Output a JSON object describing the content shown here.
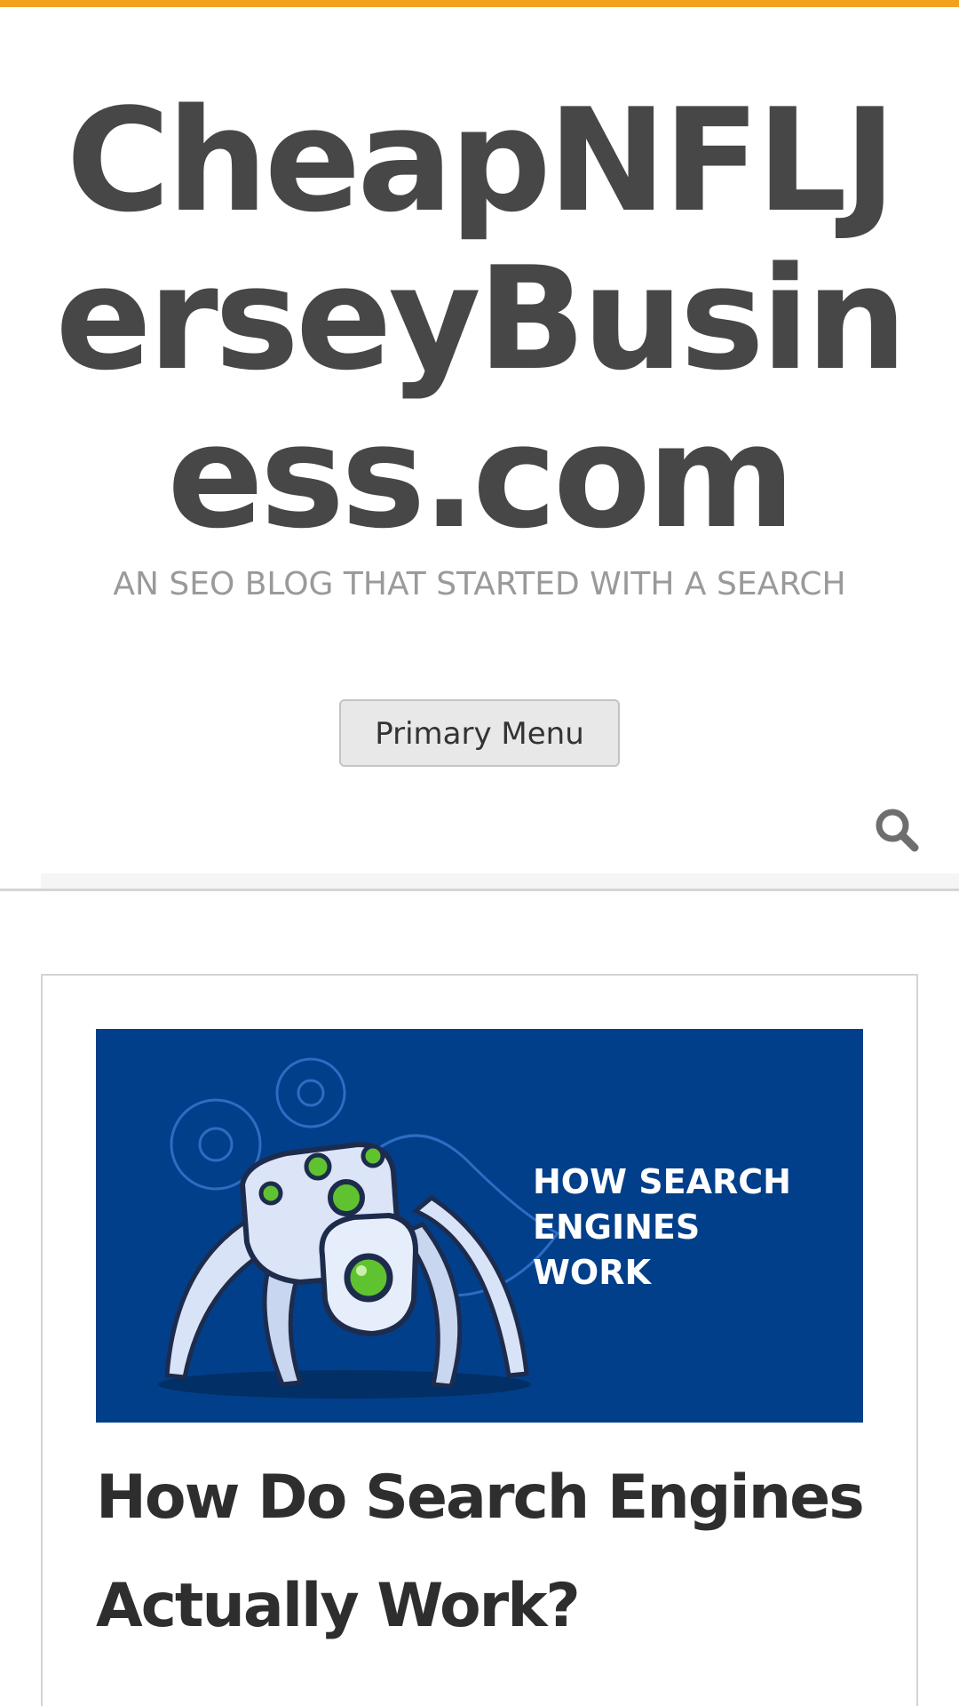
{
  "header": {
    "site_title": "CheapNFLJerseyBusiness.com",
    "tagline": "AN SEO BLOG THAT STARTED WITH A SEARCH",
    "menu_button_label": "Primary Menu",
    "search_icon": "search-icon"
  },
  "post": {
    "title": "How Do Search Engines Actually Work?",
    "image": {
      "caption_lines": [
        "HOW SEARCH",
        "ENGINES",
        "WORK"
      ],
      "subject": "robot-spider-illustration"
    }
  },
  "colors": {
    "accent": "#f3a01f",
    "title_text": "#474747",
    "tagline_text": "#9a9a9a",
    "image_bg": "#023f8a",
    "robot_eye": "#5fc22f"
  }
}
